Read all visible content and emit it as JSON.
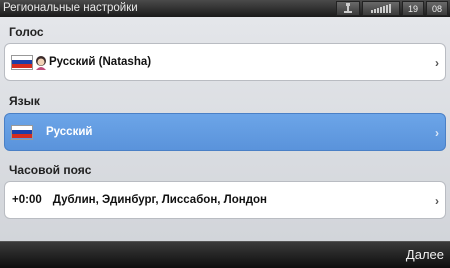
{
  "window": {
    "title": "Региональные настройки"
  },
  "status_bar": {
    "hour": "19",
    "minute": "08"
  },
  "sections": {
    "voice": {
      "label": "Голос",
      "value": "Русский (Natasha)",
      "flag_colors": [
        "#ffffff",
        "#1c3fa8",
        "#d52b1e"
      ],
      "icons": [
        "russia-flag-icon",
        "voice-avatar-icon",
        "chevron-right-icon"
      ]
    },
    "language": {
      "label": "Язык",
      "value": "Русский",
      "selected": true,
      "flag_colors": [
        "#ffffff",
        "#1c3fa8",
        "#d52b1e"
      ],
      "icons": [
        "russia-flag-icon",
        "chevron-right-icon"
      ]
    },
    "timezone": {
      "label": "Часовой пояс",
      "offset": "+0:00",
      "name": "Дублин, Эдинбург, Лиссабон, Лондон",
      "icons": [
        "chevron-right-icon"
      ]
    }
  },
  "footer": {
    "next_label": "Далее"
  },
  "colors": {
    "selected_row": "#5f9ae0",
    "titlebar": "#2a2a2a",
    "background": "#d9dce1"
  }
}
